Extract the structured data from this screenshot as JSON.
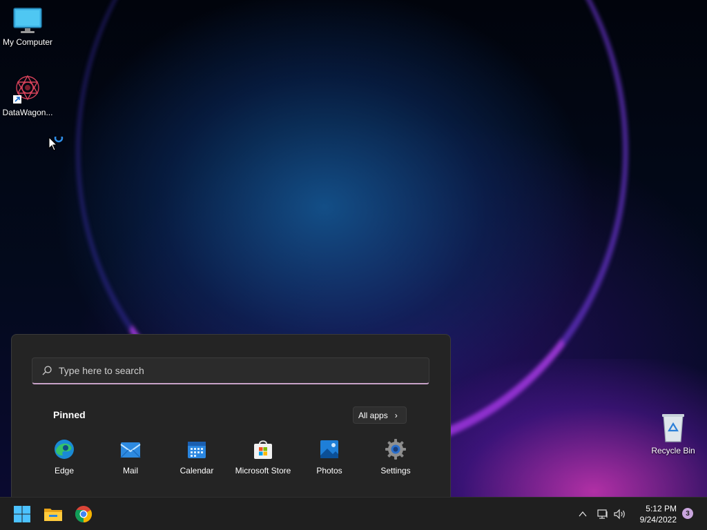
{
  "desktop": {
    "icons": [
      {
        "label": "My Computer",
        "icon": "monitor-icon"
      },
      {
        "label": "DataWagon...",
        "icon": "datawagon-shortcut-icon"
      },
      {
        "label": "Recycle Bin",
        "icon": "recycle-bin-icon"
      }
    ]
  },
  "start_menu": {
    "search_placeholder": "Type here to search",
    "pinned_title": "Pinned",
    "all_apps_label": "All apps",
    "pinned": [
      {
        "label": "Edge",
        "icon": "edge-icon"
      },
      {
        "label": "Mail",
        "icon": "mail-icon"
      },
      {
        "label": "Calendar",
        "icon": "calendar-icon"
      },
      {
        "label": "Microsoft Store",
        "icon": "store-icon"
      },
      {
        "label": "Photos",
        "icon": "photos-icon"
      },
      {
        "label": "Settings",
        "icon": "settings-icon"
      }
    ]
  },
  "taskbar": {
    "apps": [
      {
        "icon": "windows-start-icon"
      },
      {
        "icon": "file-explorer-icon"
      },
      {
        "icon": "chrome-icon"
      }
    ],
    "tray": {
      "time": "5:12 PM",
      "date": "9/24/2022",
      "notification_count": "3"
    }
  },
  "colors": {
    "start_menu_bg": "#242424",
    "taskbar_bg": "#1f1f1f",
    "accent": "#c9a5dd"
  }
}
